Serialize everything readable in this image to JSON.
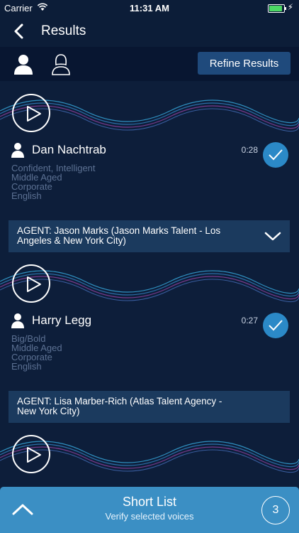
{
  "status_bar": {
    "carrier": "Carrier",
    "time": "11:31 AM"
  },
  "nav": {
    "title": "Results"
  },
  "filter": {
    "refine_label": "Refine Results"
  },
  "results": [
    {
      "name": "Dan Nachtrab",
      "duration": "0:28",
      "attributes": [
        "Confident,  Intelligent",
        "Middle Aged",
        "Corporate",
        "English"
      ],
      "agent": "AGENT: Jason Marks (Jason Marks Talent - Los Angeles & New York City)"
    },
    {
      "name": "Harry Legg",
      "duration": "0:27",
      "attributes": [
        "Big/Bold",
        "Middle Aged",
        "Corporate",
        "English"
      ],
      "agent": "AGENT: Lisa Marber-Rich (Atlas Talent Agency - New York City)"
    },
    {}
  ],
  "shortlist": {
    "title": "Short List",
    "subtitle": "Verify selected voices",
    "count": "3"
  },
  "colors": {
    "background": "#0d1e3a",
    "accent": "#2b89c7",
    "shortlist": "#3b8fc4",
    "agent_bar": "#1b3a5e"
  }
}
